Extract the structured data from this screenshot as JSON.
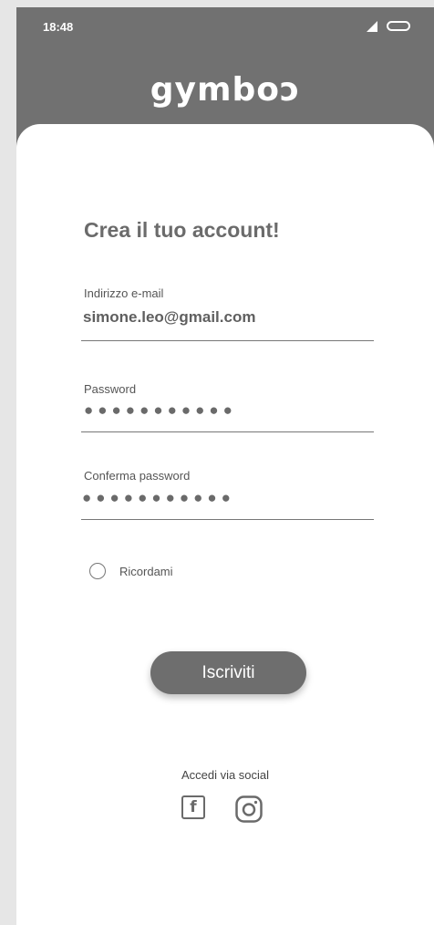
{
  "status_bar": {
    "time": "18:48"
  },
  "header": {
    "logo": "gymboɔ"
  },
  "form": {
    "title": "Crea il tuo account!",
    "email": {
      "label": "Indirizzo e-mail",
      "value": "simone.leo@gmail.com"
    },
    "password": {
      "label": "Password",
      "value": "●●●●●●●●●●●"
    },
    "confirm_password": {
      "label": "Conferma password",
      "value": "●●●●●●●●●●●"
    },
    "remember": {
      "label": "Ricordami",
      "checked": false
    },
    "submit_label": "Iscriviti"
  },
  "social": {
    "label": "Accedi via social",
    "icons": [
      "facebook-icon",
      "instagram-icon"
    ]
  },
  "colors": {
    "header_bg": "#717171",
    "button_bg": "#6e6e6e"
  }
}
